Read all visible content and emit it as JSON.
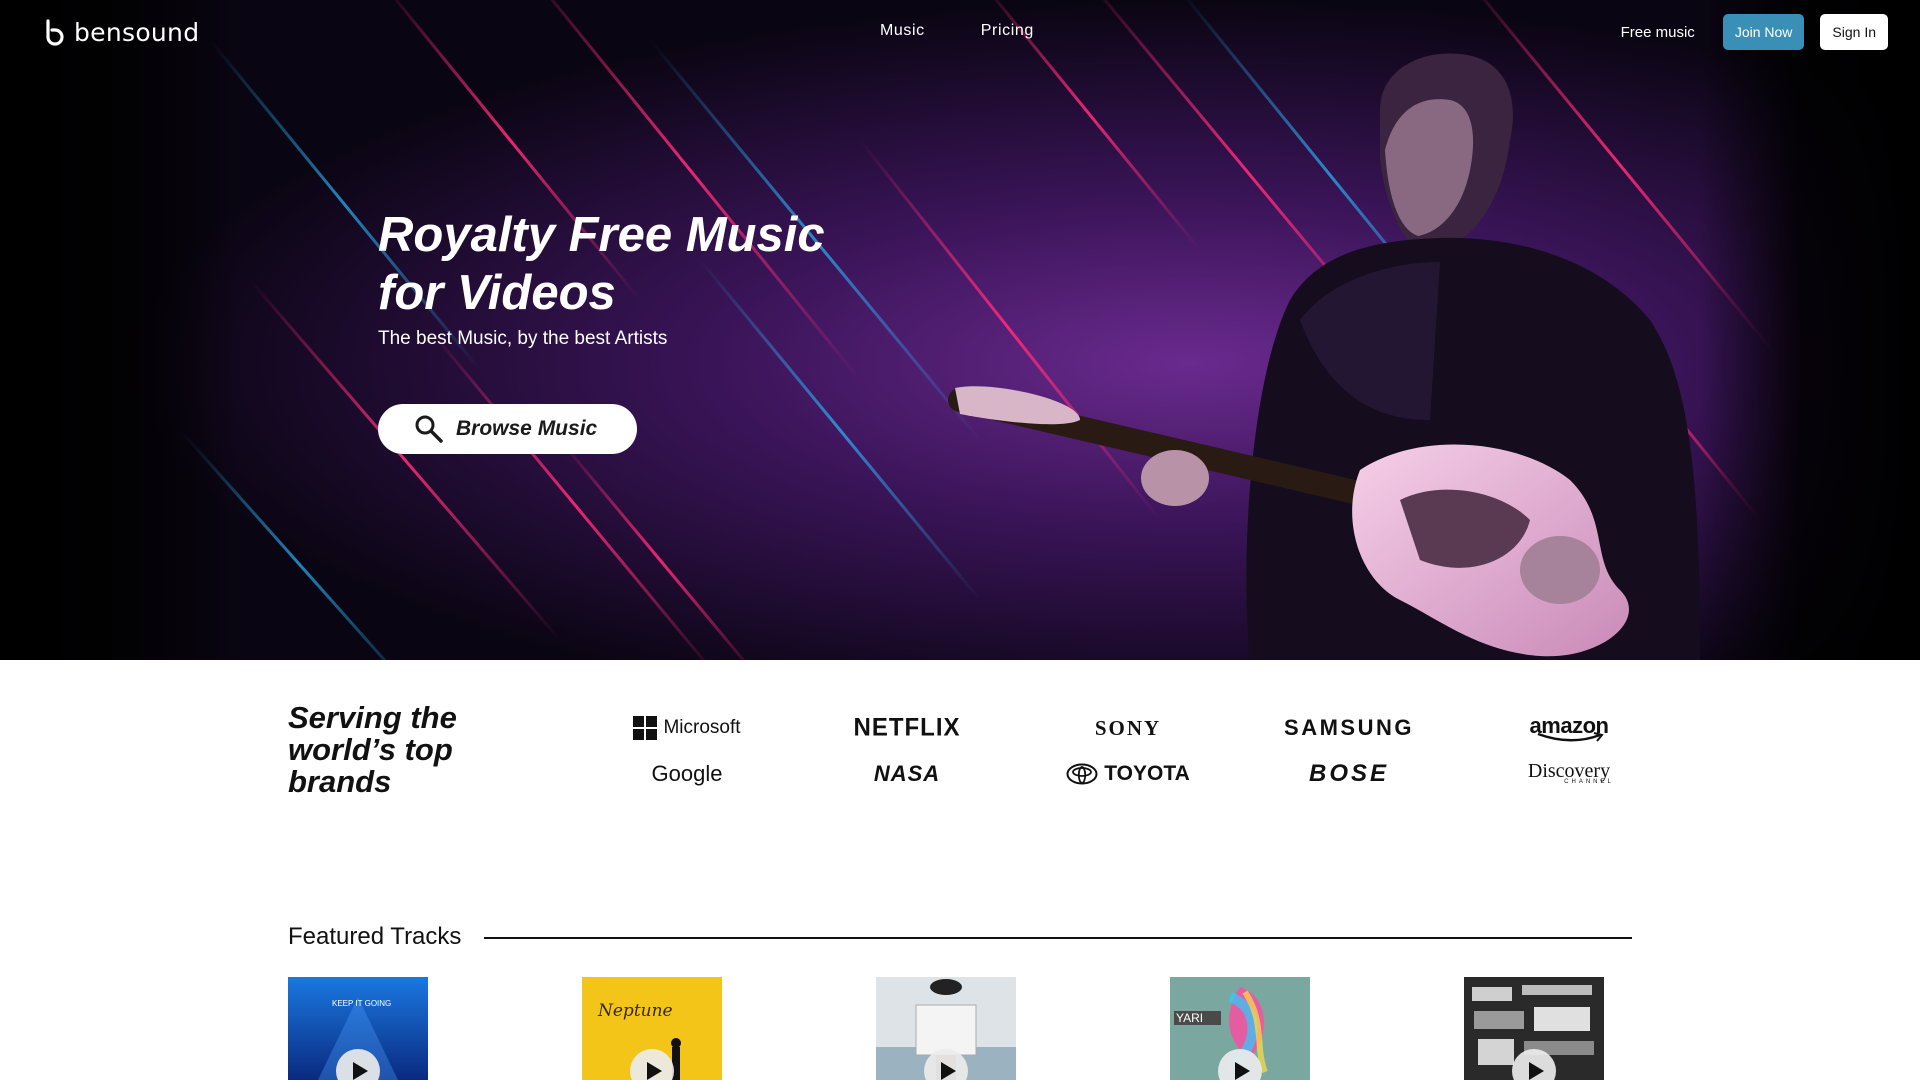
{
  "brand": {
    "logo_text": "bensound",
    "logo_icon": "bensound-logo-icon"
  },
  "nav": {
    "links": [
      "Music",
      "Pricing"
    ],
    "free_music": "Free music",
    "join_now": "Join Now",
    "sign_in": "Sign In"
  },
  "hero": {
    "title_line1": "Royalty Free Music",
    "title_line2": "for Videos",
    "subtitle": "The best Music, by the best Artists",
    "browse_label": "Browse Music",
    "browse_icon": "search-icon"
  },
  "brands": {
    "title_line1": "Serving the",
    "title_line2": "world’s top",
    "title_line3": "brands",
    "logos": [
      "Microsoft",
      "NETFLIX",
      "SONY",
      "SAMSUNG",
      "amazon",
      "Google",
      "NASA",
      "TOYOTA",
      "BOSE",
      "Discovery"
    ],
    "discovery_sub": "CHANNEL"
  },
  "featured": {
    "title": "Featured Tracks",
    "tracks": [
      {
        "art_text": "KEEP IT GOING",
        "play_icon": "play-icon"
      },
      {
        "art_text": "Neptune",
        "play_icon": "play-icon"
      },
      {
        "art_text": "",
        "play_icon": "play-icon"
      },
      {
        "art_text": "YARI",
        "play_icon": "play-icon"
      },
      {
        "art_text": "",
        "play_icon": "play-icon"
      }
    ]
  },
  "colors": {
    "join_button": "#3a8fb7",
    "hero_purple": "#7a2a9a",
    "hero_pink": "#ff2a7a"
  }
}
